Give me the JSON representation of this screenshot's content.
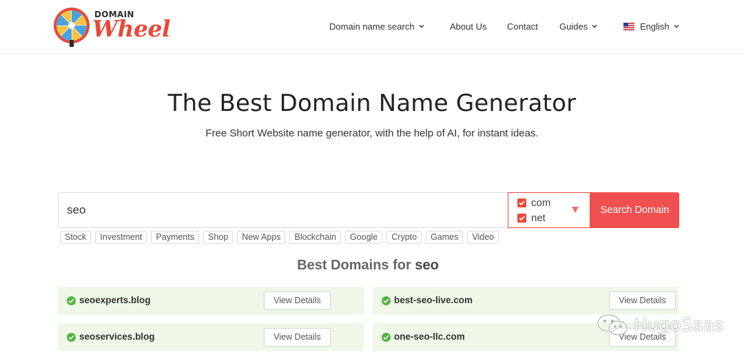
{
  "logo": {
    "line1": "DOMAIN",
    "line2": "Wheel"
  },
  "nav": {
    "domain_search": "Domain name search",
    "about": "About Us",
    "contact": "Contact",
    "guides": "Guides",
    "language": "English"
  },
  "hero": {
    "title": "The Best Domain Name Generator",
    "subtitle": "Free Short Website name generator, with the help of AI, for instant ideas."
  },
  "search": {
    "value": "seo",
    "tlds": [
      {
        "label": "com",
        "checked": true
      },
      {
        "label": "net",
        "checked": true
      }
    ],
    "button": "Search Domain"
  },
  "tags": [
    "Stock",
    "Investment",
    "Payments",
    "Shop",
    "New Apps",
    "Blockchain",
    "Google",
    "Crypto",
    "Games",
    "Video"
  ],
  "best": {
    "prefix": "Best Domains for",
    "keyword": "seo"
  },
  "results": [
    {
      "name": "seoexperts.blog",
      "button": "View Details"
    },
    {
      "name": "best-seo-live.com",
      "button": "View Details"
    },
    {
      "name": "seoservices.blog",
      "button": "View Details"
    },
    {
      "name": "one-seo-llc.com",
      "button": "View Details"
    }
  ],
  "watermark": "HugoSaas",
  "colors": {
    "accent": "#f05050",
    "success": "#52b43d",
    "result_bg": "#eef7e8"
  }
}
